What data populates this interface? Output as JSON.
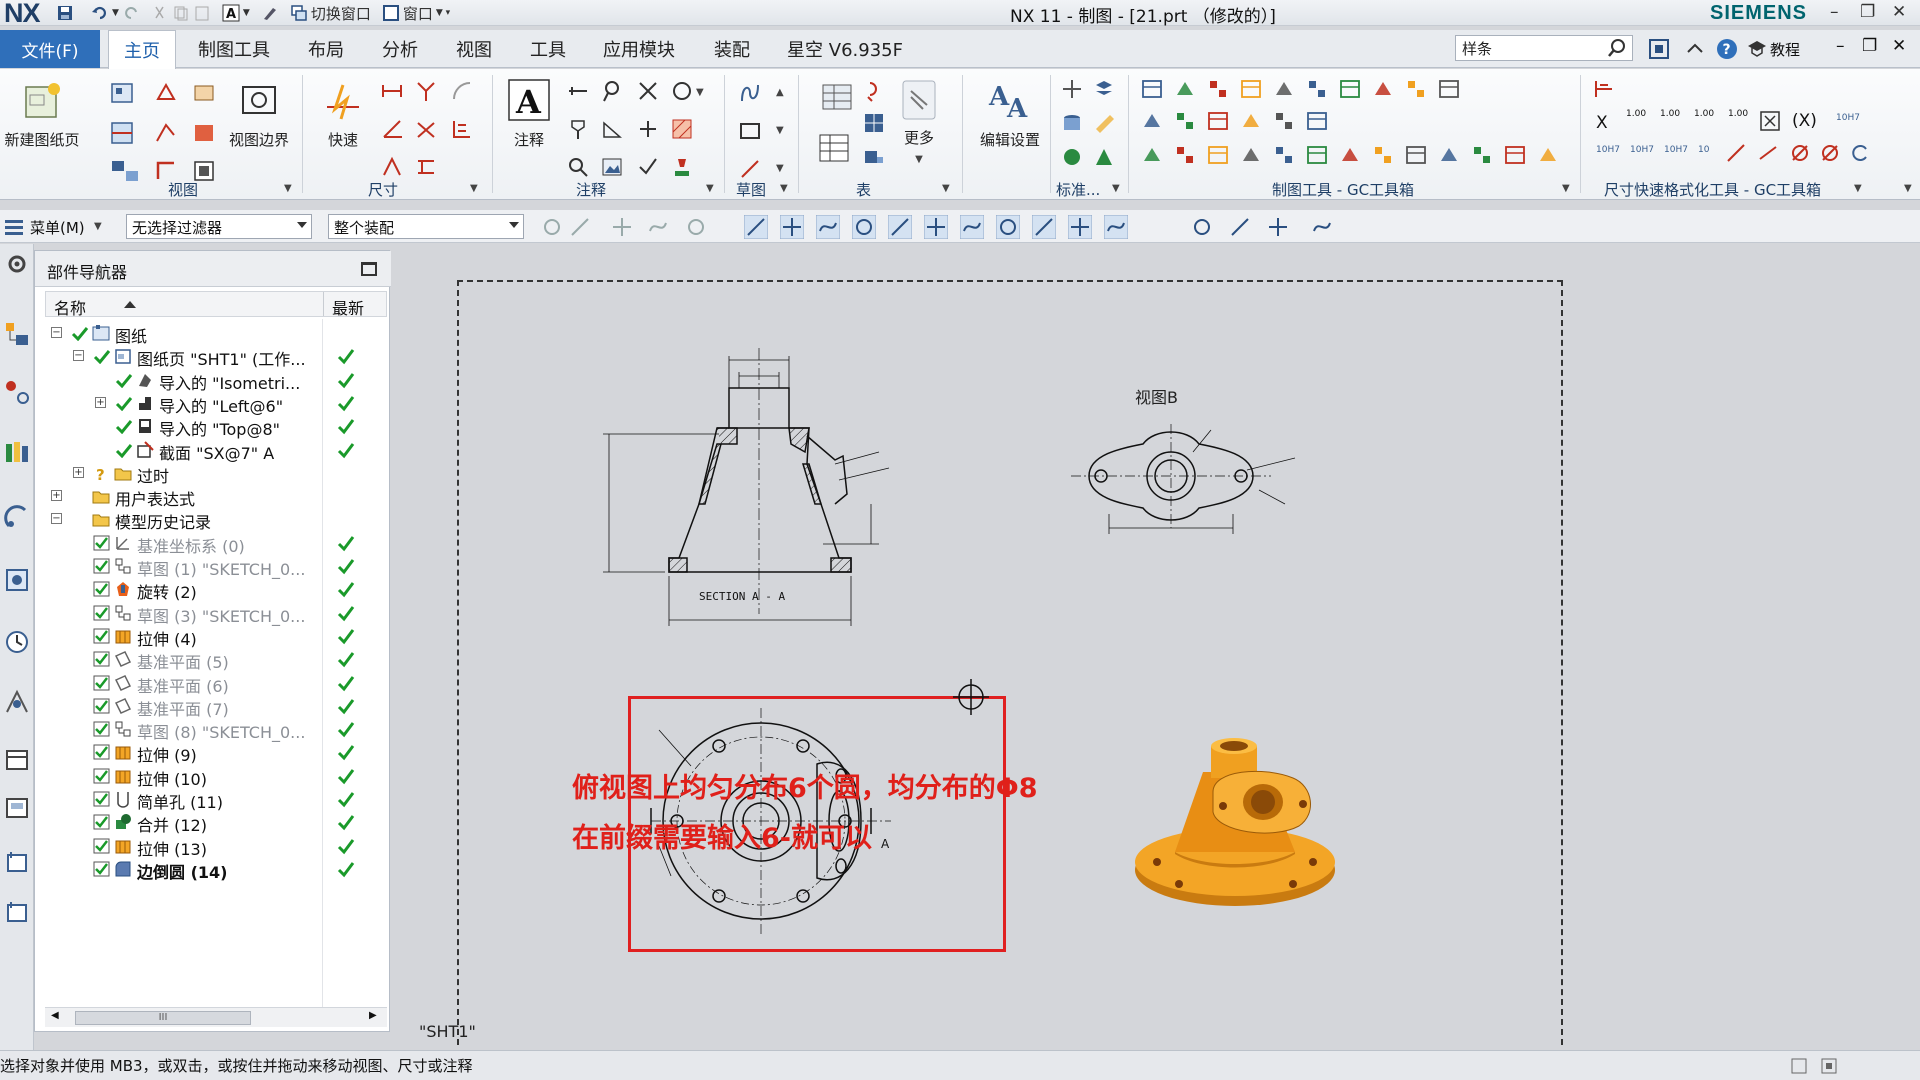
{
  "titlebar": {
    "logo": "NX",
    "switch_window": "切换窗口",
    "window_menu": "窗口",
    "title": "NX 11 - 制图 - [21.prt （修改的）]",
    "brand": "SIEMENS"
  },
  "tabs": {
    "file": "文件(F)",
    "items": [
      "主页",
      "制图工具",
      "布局",
      "分析",
      "视图",
      "工具",
      "应用模块",
      "装配",
      "星空 V6.935F"
    ],
    "search_value": "样条",
    "help_label": "教程"
  },
  "ribbon": {
    "new_sheet": "新建图纸页",
    "view_group": "视图",
    "view_border": "视图边界",
    "dim_quick": "快速",
    "dim_group": "尺寸",
    "note": "注释",
    "annotation_group": "注释",
    "sketch_group": "草图",
    "table_group": "表",
    "more": "更多",
    "edit_settings": "编辑设置",
    "standard_group": "标准...",
    "gc_drafting_group": "制图工具 - GC工具箱",
    "gc_dim_group": "尺寸快速格式化工具 - GC工具箱",
    "tol_labels": [
      "1.00",
      "1.00",
      "1.00",
      "1.00"
    ],
    "fit_labels": [
      "10H7",
      "10H7",
      "10H7",
      "10"
    ]
  },
  "selection_bar": {
    "menu": "菜单(M)",
    "filter": "无选择过滤器",
    "scope": "整个装配"
  },
  "navigator": {
    "title": "部件导航器",
    "col_name": "名称",
    "col_latest": "最新",
    "rows": [
      {
        "label": "图纸",
        "style": "normal"
      },
      {
        "label": "图纸页 \"SHT1\" (工作...",
        "style": "normal"
      },
      {
        "label": "导入的 \"Isometri...",
        "style": "normal"
      },
      {
        "label": "导入的 \"Left@6\"",
        "style": "normal"
      },
      {
        "label": "导入的 \"Top@8\"",
        "style": "normal"
      },
      {
        "label": "截面 \"SX@7\" A",
        "style": "normal"
      },
      {
        "label": "过时",
        "style": "normal"
      },
      {
        "label": "用户表达式",
        "style": "normal"
      },
      {
        "label": "模型历史记录",
        "style": "normal"
      },
      {
        "label": "基准坐标系 (0)",
        "style": "dim"
      },
      {
        "label": "草图 (1) \"SKETCH_0...",
        "style": "dim"
      },
      {
        "label": "旋转 (2)",
        "style": "normal"
      },
      {
        "label": "草图 (3) \"SKETCH_0...",
        "style": "dim"
      },
      {
        "label": "拉伸 (4)",
        "style": "normal"
      },
      {
        "label": "基准平面 (5)",
        "style": "dim"
      },
      {
        "label": "基准平面 (6)",
        "style": "dim"
      },
      {
        "label": "基准平面 (7)",
        "style": "dim"
      },
      {
        "label": "草图 (8) \"SKETCH_0...",
        "style": "dim"
      },
      {
        "label": "拉伸 (9)",
        "style": "normal"
      },
      {
        "label": "拉伸 (10)",
        "style": "normal"
      },
      {
        "label": "简单孔 (11)",
        "style": "normal"
      },
      {
        "label": "合并 (12)",
        "style": "normal"
      },
      {
        "label": "拉伸 (13)",
        "style": "normal"
      },
      {
        "label": "边倒圆 (14)",
        "style": "bold"
      }
    ],
    "scroll_thumb": "III"
  },
  "canvas": {
    "sheet_name": "\"SHT1\"",
    "view_b_label": "视图B",
    "section_label": "SECTION  A - A",
    "annotation_line1": "俯视图上均匀分布6个圆，均分布的Φ8",
    "annotation_line2": "在前缀需要输入6-就可以"
  },
  "status": {
    "text": "选择对象并使用 MB3，或双击，或按住并拖动来移动视图、尺寸或注释"
  },
  "colors": {
    "accent_blue": "#2f6fba",
    "annotation_red": "#e0201a",
    "check_green": "#1a9a2a",
    "model_orange": "#f0a020"
  }
}
